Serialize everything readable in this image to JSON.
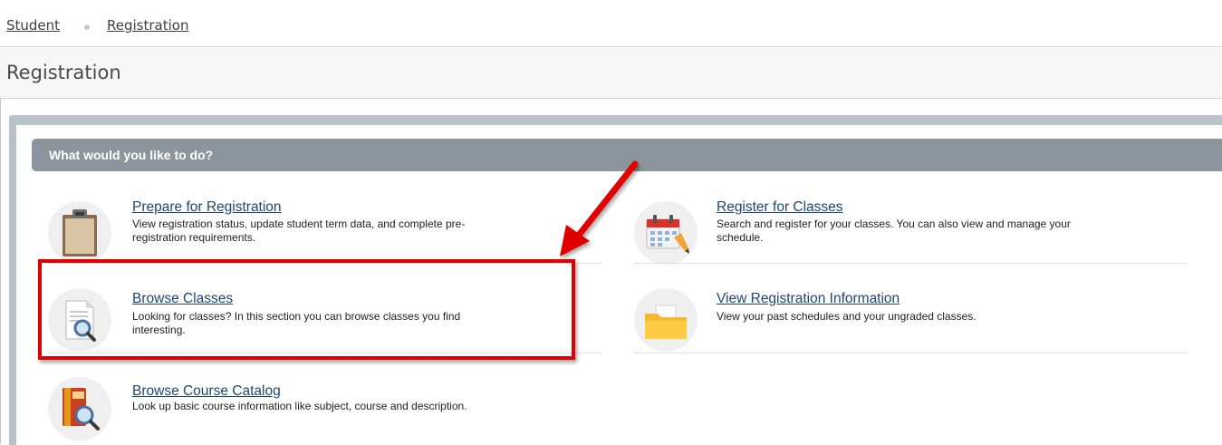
{
  "breadcrumb": {
    "items": [
      "Student",
      "Registration"
    ]
  },
  "page": {
    "title": "Registration"
  },
  "section": {
    "header": "What would you like to do?"
  },
  "cards": [
    {
      "title": "Prepare for Registration",
      "desc_l1": "View registration status, update student term data, and complete pre-",
      "desc_l2": "registration requirements.",
      "icon": "clipboard-icon"
    },
    {
      "title": "Register for Classes",
      "desc_l1": "Search and register for your classes. You can also view and manage your",
      "desc_l2": "schedule.",
      "icon": "calendar-icon"
    },
    {
      "title": "Browse Classes",
      "desc_l1": "Looking for classes? In this section you can browse classes you find",
      "desc_l2": "interesting.",
      "icon": "document-search-icon"
    },
    {
      "title": "View Registration Information",
      "desc_l1": "View your past schedules and your ungraded classes.",
      "desc_l2": "",
      "icon": "folder-icon"
    },
    {
      "title": "Browse Course Catalog",
      "desc_l1": "Look up basic course information like subject, course and description.",
      "desc_l2": "",
      "icon": "book-search-icon"
    }
  ],
  "colors": {
    "link": "#1d4673",
    "header": "#8c959d",
    "highlight": "#e00000",
    "outer_panel": "#b9c1ca"
  }
}
